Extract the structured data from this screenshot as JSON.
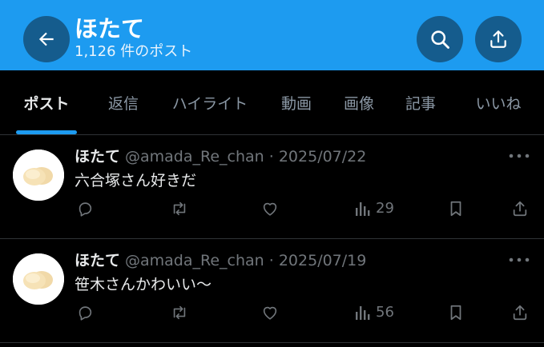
{
  "header": {
    "title": "ほたて",
    "post_count": "1,126 件のポスト"
  },
  "tabs": [
    {
      "label": "ポスト",
      "active": true
    },
    {
      "label": "返信",
      "active": false
    },
    {
      "label": "ハイライト",
      "active": false
    },
    {
      "label": "動画",
      "active": false
    },
    {
      "label": "画像",
      "active": false
    },
    {
      "label": "記事",
      "active": false
    },
    {
      "label": "いいね",
      "active": false
    }
  ],
  "posts": [
    {
      "name": "ほたて",
      "meta": "@amada_Re_chan · 2025/07/22",
      "text": "六合塚さん好きだ",
      "views": "29"
    },
    {
      "name": "ほたて",
      "meta": "@amada_Re_chan · 2025/07/19",
      "text": "笹木さんかわいい〜",
      "views": "56"
    }
  ],
  "colors": {
    "accent": "#1d9bf0",
    "background": "#000000",
    "text_primary": "#e7e9ea",
    "text_secondary": "#71767b"
  },
  "icons": [
    "arrow-left-icon",
    "search-icon",
    "share-icon",
    "reply-icon",
    "repost-icon",
    "like-icon",
    "views-icon",
    "bookmark-icon",
    "more-icon"
  ]
}
